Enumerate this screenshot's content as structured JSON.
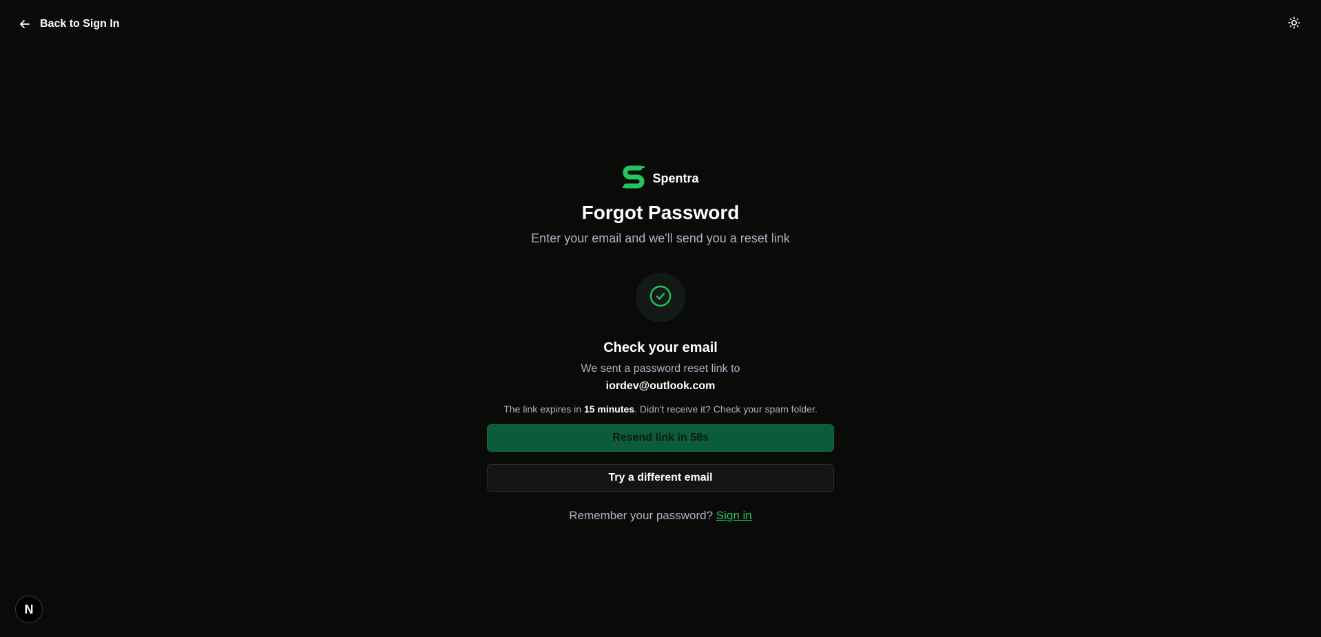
{
  "header": {
    "back_label": "Back to Sign In",
    "back_icon": "arrow-left-icon",
    "theme_icon": "sun-icon"
  },
  "brand": {
    "name": "Spentra",
    "logo_icon": "spentra-logo-icon",
    "color": "#22c55e"
  },
  "page": {
    "title": "Forgot Password",
    "subtitle": "Enter your email and we'll send you a reset link"
  },
  "confirmation": {
    "icon": "check-circle-icon",
    "heading": "Check your email",
    "sent_text": "We sent a password reset link to",
    "email": "iordev@outlook.com",
    "expiry_prefix": "The link expires in ",
    "expiry_time": "15 minutes",
    "expiry_suffix": ". Didn't receive it? Check your spam folder."
  },
  "actions": {
    "resend_label": "Resend link in 58s",
    "different_email_label": "Try a different email"
  },
  "footer": {
    "remember_text": "Remember your password? ",
    "signin_label": "Sign in"
  },
  "dev_badge": {
    "letter": "N"
  },
  "colors": {
    "background": "#0a0a09",
    "accent": "#22c55e",
    "resend_button": "#0b5c3a",
    "muted_text": "#a9b4c6"
  }
}
